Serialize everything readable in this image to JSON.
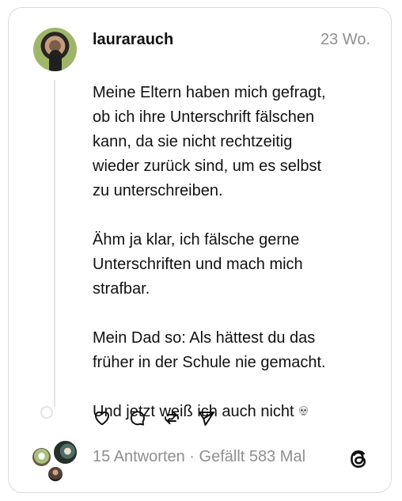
{
  "post": {
    "username": "laurarauch",
    "time": "23 Wo.",
    "text": "Meine Eltern haben mich gefragt,\nob ich ihre Unterschrift fälschen\nkann, da sie nicht rechtzeitig\nwieder zurück sind, um es selbst\nzu unterschreiben.\n\nÄhm ja klar, ich fälsche gerne\nUnterschriften und mach mich\nstrafbar.\n\nMein Dad so: Als hättest du das\nfrüher in der Schule nie gemacht.\n\nUnd jetzt weiß ich auch nicht",
    "emoji_name": "skull-icon"
  },
  "actions": {
    "like": "heart-icon",
    "reply": "comment-icon",
    "repost": "repost-icon",
    "share": "send-icon"
  },
  "meta": {
    "summary": "15 Antworten · Gefällt 583 Mal"
  },
  "colors": {
    "text": "#111111",
    "muted": "#8f8f8f",
    "line": "#e3e3e3",
    "border": "#dcdcdc"
  }
}
